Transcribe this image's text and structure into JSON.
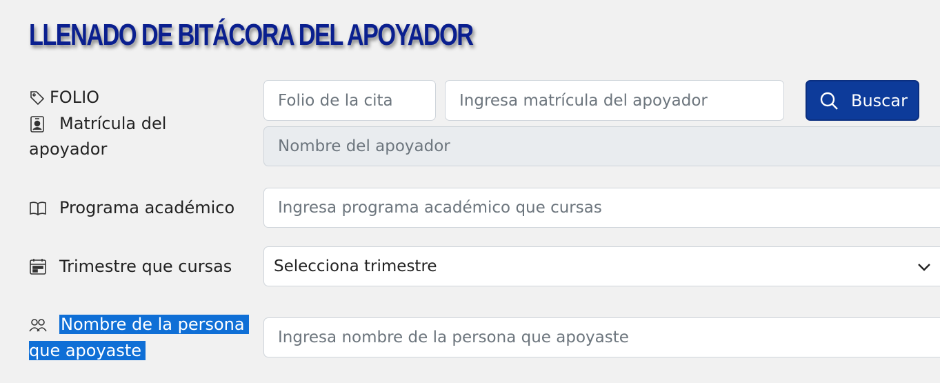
{
  "page": {
    "title": "LLENADO DE BITÁCORA DEL APOYADOR"
  },
  "form": {
    "folio_label": "FOLIO",
    "folio_placeholder": "Folio de la cita",
    "matricula_label_line1": "Matrícula del",
    "matricula_label_line2": "apoyador",
    "matricula_placeholder": "Ingresa matrícula del apoyador",
    "search_button": "Buscar",
    "nombre_apoyador_placeholder": "Nombre del apoyador",
    "programa_label": "Programa académico",
    "programa_placeholder": "Ingresa programa académico que cursas",
    "trimestre_label": "Trimestre que cursas",
    "trimestre_selected": "Selecciona trimestre",
    "persona_label_line1": "Nombre de la persona",
    "persona_label_line2": "que apoyaste",
    "persona_placeholder": "Ingresa nombre de la persona que apoyaste"
  },
  "icons": {
    "folio": "tag-icon",
    "matricula": "person-badge-icon",
    "programa": "book-icon",
    "trimestre": "calendar-icon",
    "persona": "people-icon",
    "search": "search-icon",
    "select": "chevron-down-icon"
  },
  "colors": {
    "title": "#0a1f8f",
    "button": "#0d3b9a",
    "highlight": "#0f6fd6"
  }
}
